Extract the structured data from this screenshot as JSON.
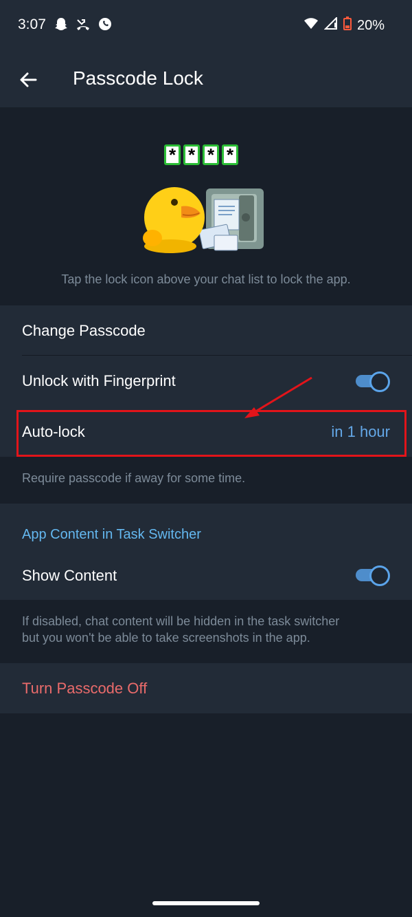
{
  "status": {
    "time": "3:07",
    "battery": "20%",
    "icons": [
      "snapchat-icon",
      "missed-call-icon",
      "whatsapp-icon",
      "wifi-icon",
      "signal-icon",
      "battery-icon"
    ]
  },
  "appbar": {
    "title": "Passcode Lock"
  },
  "hero": {
    "pin": [
      "*",
      "*",
      "*",
      "*"
    ],
    "caption": "Tap the lock icon above your chat list to lock the app."
  },
  "settings": {
    "change_passcode": "Change Passcode",
    "unlock_fingerprint": "Unlock with Fingerprint",
    "fingerprint_enabled": true,
    "auto_lock_label": "Auto-lock",
    "auto_lock_value": "in 1 hour",
    "auto_lock_hint": "Require passcode if away for some time."
  },
  "task_switcher": {
    "header": "App Content in Task Switcher",
    "show_content": "Show Content",
    "show_content_enabled": true,
    "hint_line1": "If disabled, chat content will be hidden in the task switcher",
    "hint_line2": "but you won't be able to take screenshots in the app."
  },
  "turn_off": "Turn Passcode Off",
  "colors": {
    "background": "#181f29",
    "card": "#222b37",
    "accent": "#64a8e8",
    "danger": "#ea6b6b",
    "annotation": "#e2141a"
  }
}
